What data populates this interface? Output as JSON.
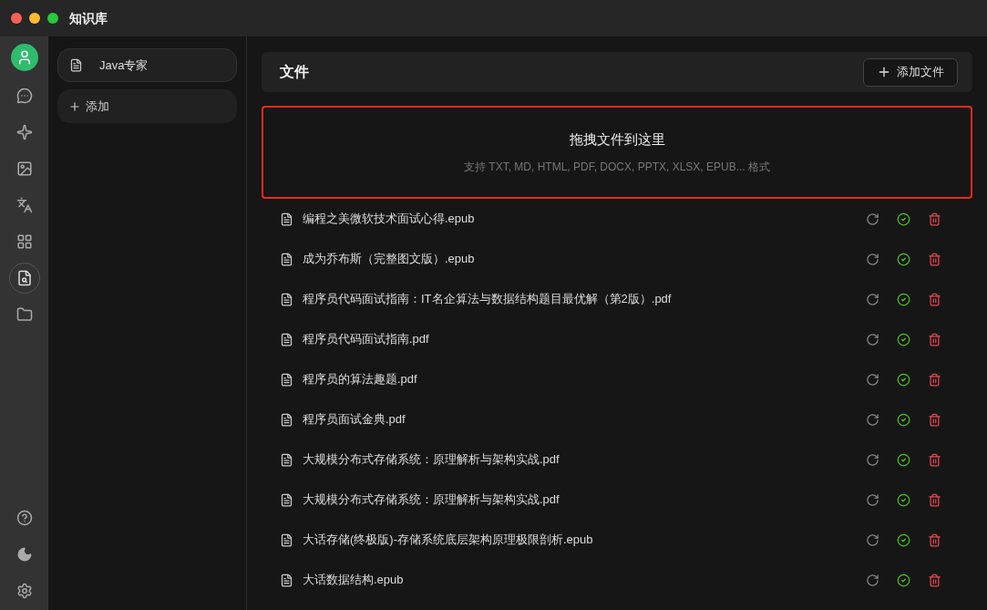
{
  "window": {
    "title": "知识库"
  },
  "nav_items": [
    {
      "selected": false
    },
    {
      "selected": false
    },
    {
      "selected": false
    },
    {
      "selected": false
    },
    {
      "selected": false
    },
    {
      "selected": true
    },
    {
      "selected": false
    }
  ],
  "knowledge_bases": [
    {
      "name": "Java专家",
      "selected": true
    }
  ],
  "add_base_button": "添加",
  "files_header": {
    "title": "文件",
    "add_button": "添加文件"
  },
  "dropzone": {
    "title": "拖拽文件到这里",
    "hint": "支持 TXT, MD, HTML, PDF, DOCX, PPTX, XLSX, EPUB... 格式",
    "highlighted": true
  },
  "files": [
    {
      "name": "编程之美微软技术面试心得.epub",
      "processed": true
    },
    {
      "name": "成为乔布斯（完整图文版）.epub",
      "processed": true
    },
    {
      "name": "程序员代码面试指南：IT名企算法与数据结构题目最优解（第2版）.pdf",
      "processed": true
    },
    {
      "name": "程序员代码面试指南.pdf",
      "processed": true
    },
    {
      "name": "程序员的算法趣题.pdf",
      "processed": true
    },
    {
      "name": "程序员面试金典.pdf",
      "processed": true
    },
    {
      "name": "大规模分布式存储系统：原理解析与架构实战.pdf",
      "processed": true
    },
    {
      "name": "大规模分布式存储系统：原理解析与架构实战.pdf",
      "processed": true
    },
    {
      "name": "大话存储(终极版)-存储系统底层架构原理极限剖析.epub",
      "processed": true
    },
    {
      "name": "大话数据结构.epub",
      "processed": true
    }
  ]
}
